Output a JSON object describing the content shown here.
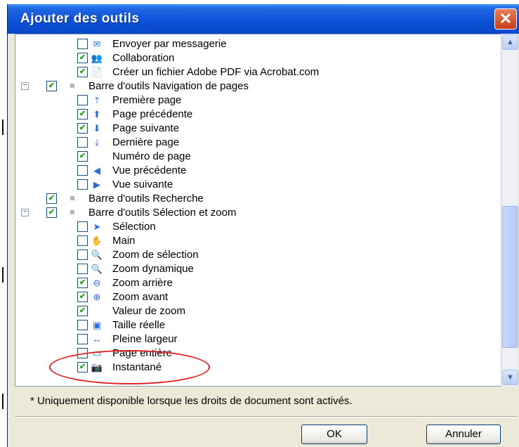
{
  "window": {
    "title": "Ajouter des outils",
    "close_glyph": "✕"
  },
  "tree": [
    {
      "level": 2,
      "checked": false,
      "icon": "envelope-icon",
      "glyph": "✉",
      "label": "Envoyer par messagerie"
    },
    {
      "level": 2,
      "checked": true,
      "icon": "people-icon",
      "glyph": "👥",
      "label": "Collaboration"
    },
    {
      "level": 2,
      "checked": true,
      "icon": "pdf-icon",
      "glyph": "📄",
      "label": "Créer un fichier Adobe PDF via Acrobat.com"
    },
    {
      "level": 1,
      "expander": "−",
      "checked": true,
      "label": "Barre d'outils Navigation de pages"
    },
    {
      "level": 2,
      "checked": false,
      "icon": "first-page-icon",
      "glyph": "⤒",
      "label": "Première page"
    },
    {
      "level": 2,
      "checked": true,
      "icon": "up-arrow-icon",
      "glyph": "⬆",
      "label": "Page précédente"
    },
    {
      "level": 2,
      "checked": true,
      "icon": "down-arrow-icon",
      "glyph": "⬇",
      "label": "Page suivante"
    },
    {
      "level": 2,
      "checked": false,
      "icon": "last-page-icon",
      "glyph": "⤓",
      "label": "Dernière page"
    },
    {
      "level": 2,
      "checked": true,
      "icon": "",
      "glyph": "",
      "label": "Numéro de page"
    },
    {
      "level": 2,
      "checked": false,
      "icon": "back-circle-icon",
      "glyph": "◀",
      "label": "Vue précédente"
    },
    {
      "level": 2,
      "checked": false,
      "icon": "forward-circle-icon",
      "glyph": "▶",
      "label": "Vue suivante"
    },
    {
      "level": 1,
      "expander": "",
      "checked": true,
      "label": "Barre d'outils Recherche"
    },
    {
      "level": 1,
      "expander": "−",
      "checked": true,
      "label": "Barre d'outils Sélection et zoom"
    },
    {
      "level": 2,
      "checked": false,
      "icon": "cursor-icon",
      "glyph": "➤",
      "label": "Sélection"
    },
    {
      "level": 2,
      "checked": false,
      "icon": "hand-icon",
      "glyph": "✋",
      "label": "Main"
    },
    {
      "level": 2,
      "checked": false,
      "icon": "zoom-selection-icon",
      "glyph": "🔍",
      "label": "Zoom de sélection"
    },
    {
      "level": 2,
      "checked": false,
      "icon": "zoom-dynamic-icon",
      "glyph": "🔍",
      "label": "Zoom dynamique"
    },
    {
      "level": 2,
      "checked": true,
      "icon": "zoom-out-icon",
      "glyph": "⊖",
      "label": "Zoom arrière"
    },
    {
      "level": 2,
      "checked": true,
      "icon": "zoom-in-icon",
      "glyph": "⊕",
      "label": "Zoom avant"
    },
    {
      "level": 2,
      "checked": true,
      "icon": "",
      "glyph": "",
      "label": "Valeur de zoom"
    },
    {
      "level": 2,
      "checked": false,
      "icon": "actual-size-icon",
      "glyph": "▣",
      "label": "Taille réelle"
    },
    {
      "level": 2,
      "checked": false,
      "icon": "fit-width-icon",
      "glyph": "↔",
      "label": "Pleine largeur"
    },
    {
      "level": 2,
      "checked": false,
      "icon": "fit-page-icon",
      "glyph": "▭",
      "label": "Page entière"
    },
    {
      "level": 2,
      "checked": true,
      "icon": "camera-icon",
      "glyph": "📷",
      "label": "Instantané"
    }
  ],
  "scroll": {
    "up": "▲",
    "down": "▼"
  },
  "footer": {
    "note": "* Uniquement disponible lorsque les droits de document sont activés."
  },
  "buttons": {
    "ok": "OK",
    "cancel": "Annuler"
  },
  "colors": {
    "titlebar": "#0b4fd6",
    "highlight": "#e02020",
    "check": "#21a121"
  }
}
